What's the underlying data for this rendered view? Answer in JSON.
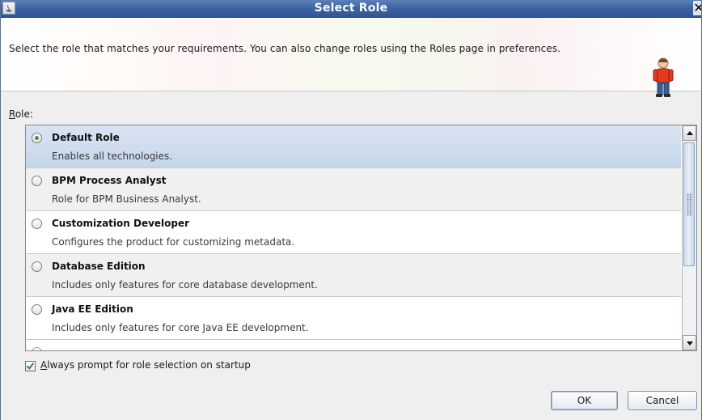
{
  "window": {
    "title": "Select Role",
    "close_glyph": "✕"
  },
  "header": {
    "instructions": "Select the role that matches your requirements. You can also change roles using the Roles page in preferences.",
    "icon": "person-icon"
  },
  "role_label": {
    "mnemonic": "R",
    "rest": "ole:"
  },
  "roles": [
    {
      "name": "Default Role",
      "description": "Enables all technologies.",
      "selected": true
    },
    {
      "name": "BPM Process Analyst",
      "description": "Role for BPM Business Analyst.",
      "selected": false
    },
    {
      "name": "Customization Developer",
      "description": "Configures the product for customizing metadata.",
      "selected": false
    },
    {
      "name": "Database Edition",
      "description": "Includes only features for core database development.",
      "selected": false
    },
    {
      "name": "Java EE Edition",
      "description": "Includes only features for core Java EE development.",
      "selected": false
    }
  ],
  "startup_prompt": {
    "mnemonic": "A",
    "rest": "lways prompt for role selection on startup",
    "checked": true
  },
  "buttons": {
    "ok": "OK",
    "cancel": "Cancel"
  },
  "colors": {
    "titlebar": "#3f64a3",
    "selection": "#c5d6ea",
    "radio_dot": "#3b9a3b"
  }
}
